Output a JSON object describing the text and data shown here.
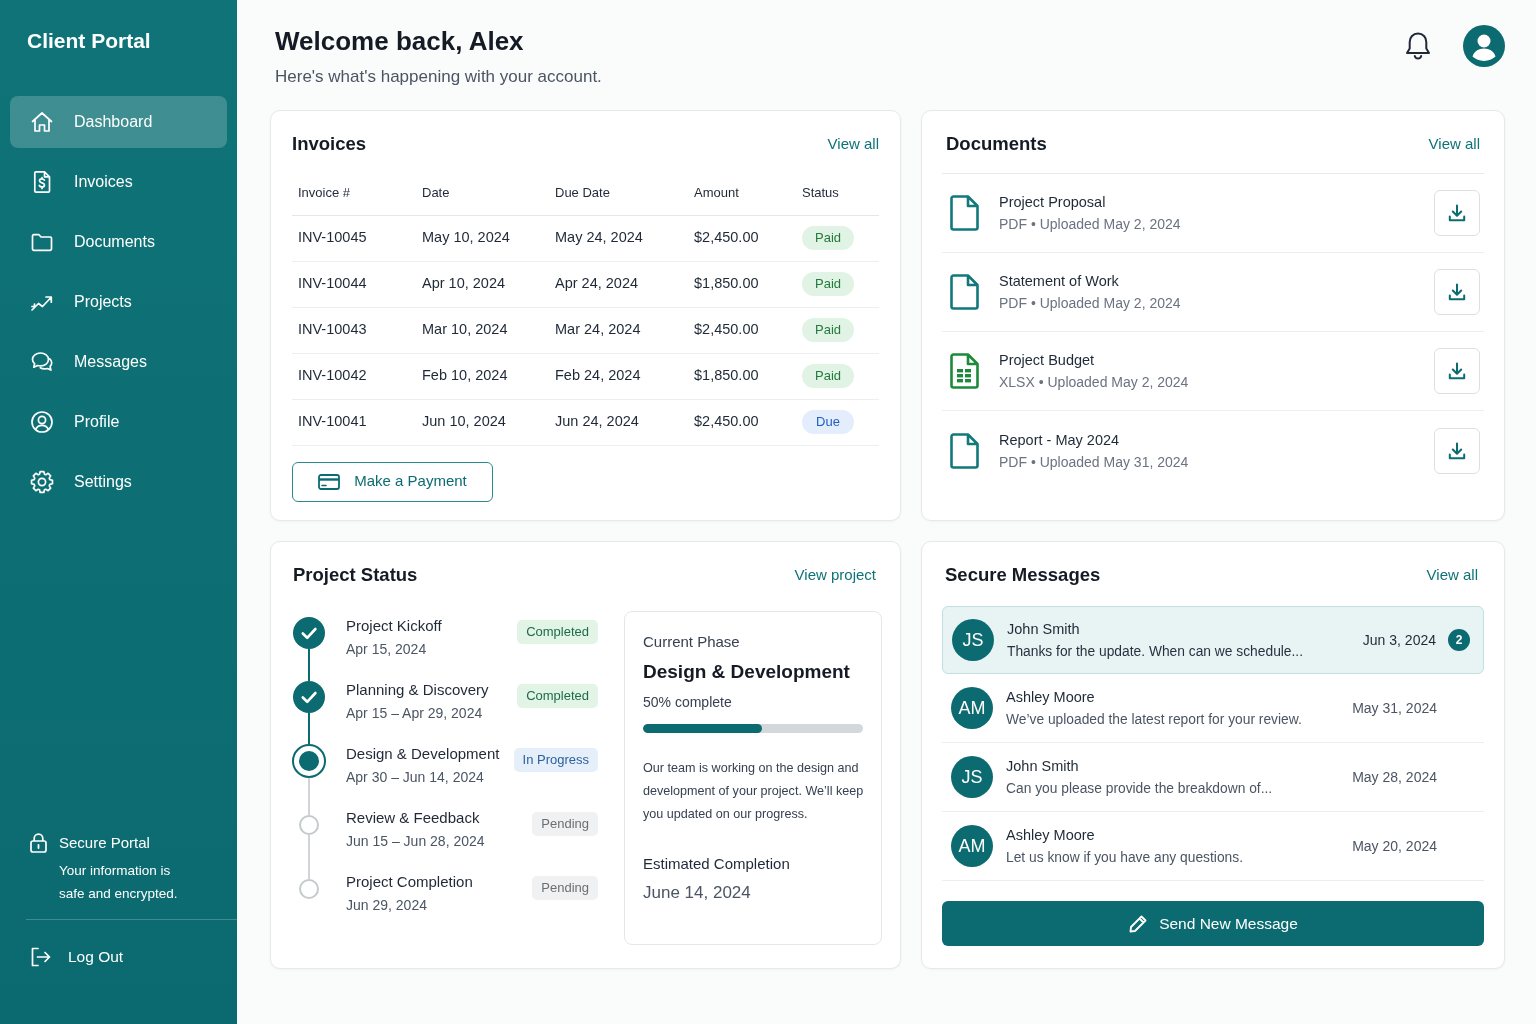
{
  "sidebar": {
    "brand": "Client Portal",
    "items": [
      {
        "label": "Dashboard",
        "selected": true
      },
      {
        "label": "Invoices",
        "selected": false
      },
      {
        "label": "Documents",
        "selected": false
      },
      {
        "label": "Projects",
        "selected": false
      },
      {
        "label": "Messages",
        "selected": false
      },
      {
        "label": "Profile",
        "selected": false
      },
      {
        "label": "Settings",
        "selected": false
      }
    ],
    "security_note": {
      "title": "Secure Portal",
      "text": "Your information is safe and encrypted."
    },
    "logout": "Log Out"
  },
  "header": {
    "title": "Welcome back, Alex",
    "subtitle": "Here's what's happening with your account."
  },
  "invoices": {
    "title": "Invoices",
    "link": "View all",
    "columns": [
      "Invoice #",
      "Date",
      "Due Date",
      "Amount",
      "Status"
    ],
    "rows": [
      {
        "number": "INV-10045",
        "date": "May 10, 2024",
        "due_date": "May 24, 2024",
        "amount": "$2,450.00",
        "status": "Paid",
        "kind": "paid"
      },
      {
        "number": "INV-10044",
        "date": "Apr 10, 2024",
        "due_date": "Apr 24, 2024",
        "amount": "$1,850.00",
        "status": "Paid",
        "kind": "paid"
      },
      {
        "number": "INV-10043",
        "date": "Mar 10, 2024",
        "due_date": "Mar 24, 2024",
        "amount": "$2,450.00",
        "status": "Paid",
        "kind": "paid"
      },
      {
        "number": "INV-10042",
        "date": "Feb 10, 2024",
        "due_date": "Feb 24, 2024",
        "amount": "$1,850.00",
        "status": "Paid",
        "kind": "paid"
      },
      {
        "number": "INV-10041",
        "date": "Jun 10, 2024",
        "due_date": "Jun 24, 2024",
        "amount": "$2,450.00",
        "status": "Due",
        "kind": "due"
      }
    ],
    "button": "Make a Payment"
  },
  "documents": {
    "title": "Documents",
    "link": "View all",
    "items": [
      {
        "name": "Project Proposal",
        "meta": "PDF • Uploaded May 2, 2024",
        "kind": "document"
      },
      {
        "name": "Statement of Work",
        "meta": "PDF • Uploaded May 2, 2024",
        "kind": "document"
      },
      {
        "name": "Project Budget",
        "meta": "XLSX • Uploaded May 2, 2024",
        "kind": "spreadsheet"
      },
      {
        "name": "Report - May 2024",
        "meta": "PDF • Uploaded May 31, 2024",
        "kind": "document"
      }
    ]
  },
  "project_status": {
    "title": "Project Status",
    "link": "View project",
    "phases": [
      {
        "name": "Project Kickoff",
        "dates": "Apr 15, 2024",
        "status": "Completed",
        "kind": "completed"
      },
      {
        "name": "Planning & Discovery",
        "dates": "Apr 15 – Apr 29, 2024",
        "status": "Completed",
        "kind": "completed"
      },
      {
        "name": "Design & Development",
        "dates": "Apr 30 – Jun 14, 2024",
        "status": "In Progress",
        "kind": "current"
      },
      {
        "name": "Review & Feedback",
        "dates": "Jun 15 – Jun 28, 2024",
        "status": "Pending",
        "kind": "pending"
      },
      {
        "name": "Project Completion",
        "dates": "Jun 29, 2024",
        "status": "Pending",
        "kind": "pending"
      }
    ],
    "current_phase": {
      "label": "Current Phase",
      "name": "Design & Development",
      "progress_text": "50% complete",
      "level": 0.54,
      "description": "Our team is working on the design and development of your project. We’ll keep you updated on our progress.",
      "estimate_label": "Estimated Completion",
      "estimate": "June 14, 2024"
    }
  },
  "messages": {
    "title": "Secure Messages",
    "link": "View all",
    "items": [
      {
        "initials": "JS",
        "sender": "John Smith",
        "preview": "Thanks for the update. When can we schedule...",
        "date": "Jun 3, 2024",
        "unread_count": "2",
        "selected": true
      },
      {
        "initials": "AM",
        "sender": "Ashley Moore",
        "preview": "We’ve uploaded the latest report for your review.",
        "date": "May 31, 2024",
        "selected": false
      },
      {
        "initials": "JS",
        "sender": "John Smith",
        "preview": "Can you please provide the breakdown of...",
        "date": "May 28, 2024",
        "selected": false
      },
      {
        "initials": "AM",
        "sender": "Ashley Moore",
        "preview": "Let us know if you have any questions.",
        "date": "May 20, 2024",
        "selected": false
      }
    ],
    "button": "Send New Message"
  }
}
